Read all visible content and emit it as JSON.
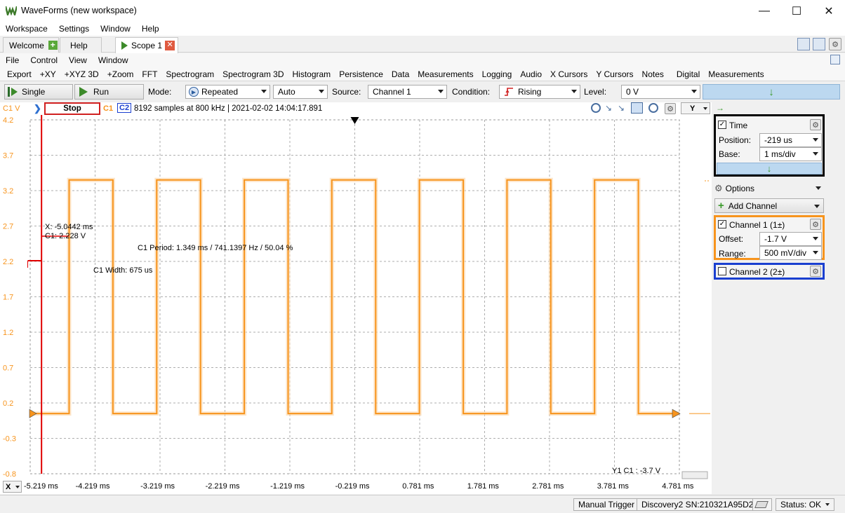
{
  "window": {
    "title": "WaveForms (new workspace)"
  },
  "main_menu": [
    "Workspace",
    "Settings",
    "Window",
    "Help"
  ],
  "tabs": [
    {
      "label": "Welcome"
    },
    {
      "label": "Help"
    },
    {
      "label": "Scope 1"
    }
  ],
  "scope_menu": [
    "File",
    "Control",
    "View",
    "Window"
  ],
  "scope_toolbar": [
    "Export",
    "+XY",
    "+XYZ 3D",
    "+Zoom",
    "FFT",
    "Spectrogram",
    "Spectrogram 3D",
    "Histogram",
    "Persistence",
    "Data",
    "Measurements",
    "Logging",
    "Audio",
    "X Cursors",
    "Y Cursors",
    "Notes",
    "Digital",
    "Measurements"
  ],
  "controls": {
    "single": "Single",
    "run": "Run",
    "mode_label": "Mode:",
    "mode_value": "Repeated",
    "auto_value": "Auto",
    "source_label": "Source:",
    "source_value": "Channel 1",
    "condition_label": "Condition:",
    "condition_value": "Rising",
    "level_label": "Level:",
    "level_value": "0 V"
  },
  "status_row": {
    "y_unit": "C1 V",
    "state": "Stop",
    "c1": "C1",
    "c2": "C2",
    "info": "8192 samples at 800 kHz | 2021-02-02 14:04:17.891",
    "y_button": "Y"
  },
  "plot": {
    "y_ticks": [
      "4.2",
      "3.7",
      "3.2",
      "2.7",
      "2.2",
      "1.7",
      "1.2",
      "0.7",
      "0.2",
      "-0.3",
      "-0.8"
    ],
    "x_ticks": [
      "-5.219 ms",
      "-4.219 ms",
      "-3.219 ms",
      "-2.219 ms",
      "-1.219 ms",
      "-0.219 ms",
      "0.781 ms",
      "1.781 ms",
      "2.781 ms",
      "3.781 ms",
      "4.781 ms"
    ],
    "x_button": "X",
    "cursor_x": "X: -5.0442 ms",
    "cursor_c1": "C1: 2.228 V",
    "period_text": "C1 Period: 1.349 ms / 741.1397 Hz / 50.04 %",
    "width_text": "C1 Width: 675 us",
    "y1_text": "Y1 C1 : -3.7 V",
    "colors": {
      "channel1": "#f7941d",
      "cursor": "#e00000",
      "grid": "#9a9a9a"
    }
  },
  "chart_data": {
    "type": "line",
    "title": "",
    "xlabel": "",
    "ylabel": "C1 V",
    "xlim": [
      -5.219,
      4.781
    ],
    "ylim": [
      -0.8,
      4.2
    ],
    "series": [
      {
        "name": "C1",
        "x": [
          -5.219,
          -4.619,
          -4.619,
          -3.944,
          -3.944,
          -3.27,
          -3.27,
          -2.595,
          -2.595,
          -1.921,
          -1.921,
          -1.246,
          -1.246,
          -0.572,
          -0.572,
          0.103,
          0.103,
          0.777,
          0.777,
          1.452,
          1.452,
          2.126,
          2.126,
          2.801,
          2.801,
          3.475,
          3.475,
          4.15,
          4.15,
          4.781
        ],
        "y": [
          0.05,
          0.05,
          3.35,
          3.35,
          0.05,
          0.05,
          3.35,
          3.35,
          0.05,
          0.05,
          3.35,
          3.35,
          0.05,
          0.05,
          3.35,
          3.35,
          0.05,
          0.05,
          3.35,
          3.35,
          0.05,
          0.05,
          3.35,
          3.35,
          0.05,
          0.05,
          3.35,
          3.35,
          0.05,
          0.05
        ]
      }
    ],
    "grid": true
  },
  "right_panel": {
    "time_label": "Time",
    "position_label": "Position:",
    "position_value": "-219 us",
    "base_label": "Base:",
    "base_value": "1 ms/div",
    "options_label": "Options",
    "add_channel": "Add Channel",
    "ch1_label": "Channel 1 (1±)",
    "offset_label": "Offset:",
    "offset_value": "-1.7 V",
    "range_label": "Range:",
    "range_value": "500 mV/div",
    "ch2_label": "Channel 2 (2±)"
  },
  "bottom": {
    "manual_trigger": "Manual Trigger",
    "device": "Discovery2 SN:210321A95D28",
    "status": "Status: OK"
  }
}
